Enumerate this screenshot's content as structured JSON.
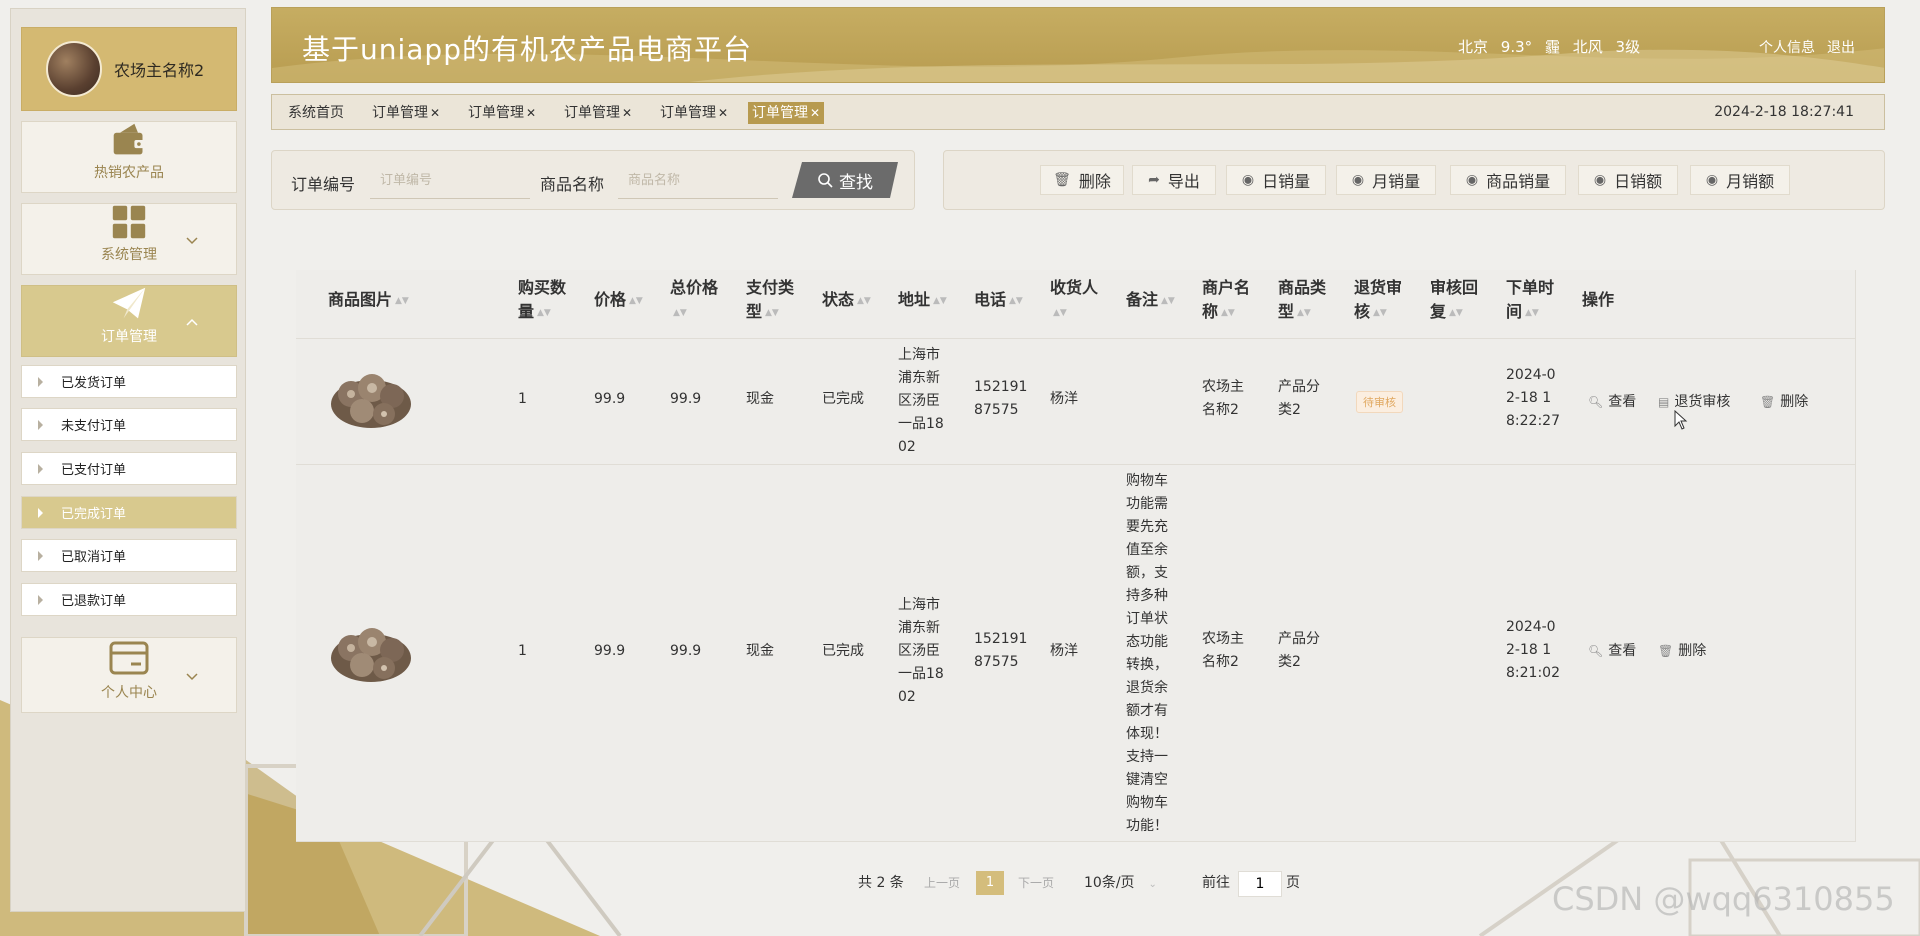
{
  "sidebar": {
    "user_name": "农场主名称2",
    "menus": [
      {
        "label": "热销农产品",
        "icon": "wallet-icon"
      },
      {
        "label": "系统管理",
        "icon": "grid-icon"
      },
      {
        "label": "订单管理",
        "icon": "paper-plane-icon"
      },
      {
        "label": "个人中心",
        "icon": "card-icon"
      }
    ],
    "order_subitems": [
      "已发货订单",
      "未支付订单",
      "已支付订单",
      "已完成订单",
      "已取消订单",
      "已退款订单"
    ]
  },
  "header": {
    "title": "基于uniapp的有机农产品电商平台",
    "weather": {
      "city": "北京",
      "temp": "9.3°",
      "condition": "霾",
      "wind": "北风",
      "level": "3级"
    },
    "profile_link": "个人信息",
    "logout_link": "退出"
  },
  "tags": [
    "系统首页",
    "订单管理",
    "订单管理",
    "订单管理",
    "订单管理",
    "订单管理"
  ],
  "datetime": "2024-2-18 18:27:41",
  "search": {
    "order_no_label": "订单编号",
    "order_no_placeholder": "订单编号",
    "product_label": "商品名称",
    "product_placeholder": "商品名称",
    "button": "查找"
  },
  "actions": [
    "删除",
    "导出",
    "日销量",
    "月销量",
    "商品销量",
    "日销额",
    "月销额"
  ],
  "table": {
    "headers": {
      "img": "商品图片",
      "qty": [
        "购买数",
        "量"
      ],
      "price": "价格",
      "total": [
        "总价格",
        ""
      ],
      "paytype": [
        "支付类",
        "型"
      ],
      "status": "状态",
      "addr": "地址",
      "phone": "电话",
      "receiver": [
        "收货人",
        ""
      ],
      "note": "备注",
      "merchant": [
        "商户名",
        "称"
      ],
      "ptype": [
        "商品类",
        "型"
      ],
      "refund": [
        "退货审",
        "核"
      ],
      "reply": [
        "审核回",
        "复"
      ],
      "time": [
        "下单时",
        "间"
      ],
      "ops": "操作"
    },
    "rows": [
      {
        "qty": "1",
        "price": "99.9",
        "total": "99.9",
        "paytype": "现金",
        "status": "已完成",
        "addr": [
          "上海市",
          "浦东新",
          "区汤臣",
          "一品18",
          "02"
        ],
        "phone": [
          "152191",
          "87575"
        ],
        "receiver": "杨洋",
        "note": [],
        "merchant": [
          "农场主",
          "名称2"
        ],
        "ptype": [
          "产品分",
          "类2"
        ],
        "refund": "待审核",
        "time": [
          "2024-0",
          "2-18 1",
          "8:22:27"
        ],
        "ops": [
          "查看",
          "退货审核",
          "删除"
        ]
      },
      {
        "qty": "1",
        "price": "99.9",
        "total": "99.9",
        "paytype": "现金",
        "status": "已完成",
        "addr": [
          "上海市",
          "浦东新",
          "区汤臣",
          "一品18",
          "02"
        ],
        "phone": [
          "152191",
          "87575"
        ],
        "receiver": "杨洋",
        "note": [
          "购物车",
          "功能需",
          "要先充",
          "值至余",
          "额，支",
          "持多种",
          "订单状",
          "态功能",
          "转换，",
          "退货余",
          "额才有",
          "体现！",
          "支持一",
          "键清空",
          "购物车",
          "功能！"
        ],
        "merchant": [
          "农场主",
          "名称2"
        ],
        "ptype": [
          "产品分",
          "类2"
        ],
        "refund": "",
        "time": [
          "2024-0",
          "2-18 1",
          "8:21:02"
        ],
        "ops": [
          "查看",
          "删除"
        ]
      }
    ]
  },
  "pagination": {
    "total": "共 2 条",
    "prev": "上一页",
    "current": "1",
    "next": "下一页",
    "page_size": "10条/页",
    "goto_label": "前往",
    "goto_value": "1",
    "page_unit": "页"
  },
  "watermark": "CSDN @wqq6310855",
  "colors": {
    "accent": "#b79a4f",
    "header": "#c6ad62",
    "badge": "#e0a860"
  }
}
